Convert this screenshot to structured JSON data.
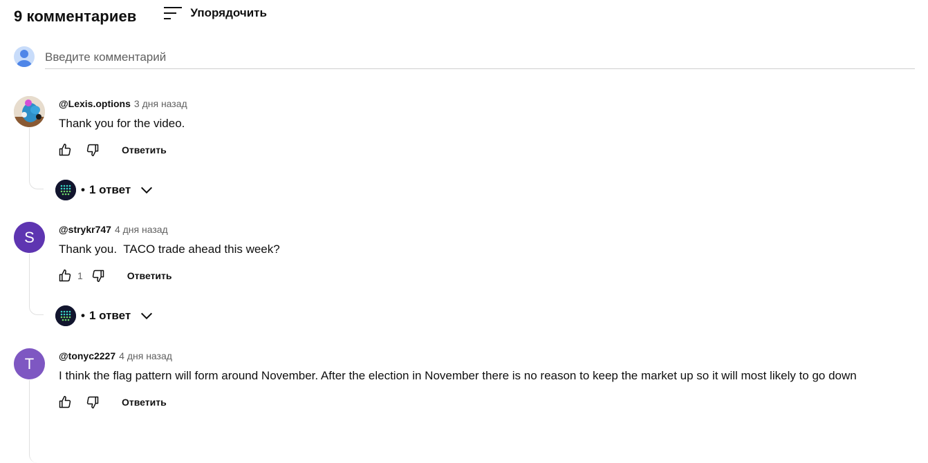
{
  "header": {
    "count_title": "9 комментариев",
    "sort_label": "Упорядочить"
  },
  "compose": {
    "placeholder": "Введите комментарий"
  },
  "reply_label": "Ответить",
  "comments": [
    {
      "author": "@Lexis.options",
      "time": "3 дня назад",
      "text": "Thank you for the video.",
      "likes": "",
      "replies_label": "1 ответ",
      "avatar_type": "photo"
    },
    {
      "author": "@strykr747",
      "time": "4 дня назад",
      "text": "Thank you.  TACO trade ahead this week?",
      "likes": "1",
      "replies_label": "1 ответ",
      "avatar_letter": "S",
      "avatar_color": "#5e35b1"
    },
    {
      "author": "@tonyc2227",
      "time": "4 дня назад",
      "text": "I think the flag pattern will form around November. After the election in November there is no reason to keep the market up so it will most likely to go down",
      "likes": "",
      "avatar_letter": "T",
      "avatar_color": "#7e57c2"
    }
  ],
  "bullet": "•",
  "icons": {
    "sort": "sort-icon",
    "like": "thumb-up-icon",
    "dislike": "thumb-down-icon",
    "expand": "chevron-down-icon"
  }
}
